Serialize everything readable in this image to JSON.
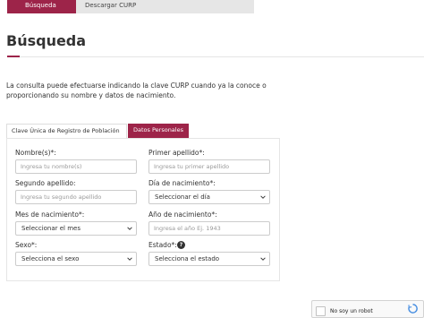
{
  "nav": {
    "tabs": [
      "Búsqueda",
      "Descargar CURP"
    ]
  },
  "page": {
    "title": "Búsqueda",
    "description": "La consulta puede efectuarse indicando la clave CURP cuando ya la conoce o proporcionando su nombre y datos de nacimiento."
  },
  "form_tabs": [
    "Clave Única de Registro de Población",
    "Datos Personales"
  ],
  "form": {
    "nombres": {
      "label": "Nombre(s)*:",
      "placeholder": "Ingresa tu nombre(s)"
    },
    "primer_apellido": {
      "label": "Primer apellido*:",
      "placeholder": "Ingresa tu primer apellido"
    },
    "segundo_apellido": {
      "label": "Segundo apellido:",
      "placeholder": "Ingresa tu segundo apellido"
    },
    "dia": {
      "label": "Día de nacimiento*:",
      "value": "Seleccionar el día"
    },
    "mes": {
      "label": "Mes de nacimiento*:",
      "value": "Seleccionar el mes"
    },
    "anio": {
      "label": "Año de nacimiento*:",
      "placeholder": "Ingresa el año Ej. 1943"
    },
    "sexo": {
      "label": "Sexo*:",
      "value": "Selecciona el sexo"
    },
    "estado": {
      "label": "Estado*:",
      "value": "Selecciona el estado"
    }
  },
  "help_icon": "?",
  "recaptcha": {
    "label": "No soy un robot"
  },
  "colors": {
    "accent": "#9d2449"
  }
}
